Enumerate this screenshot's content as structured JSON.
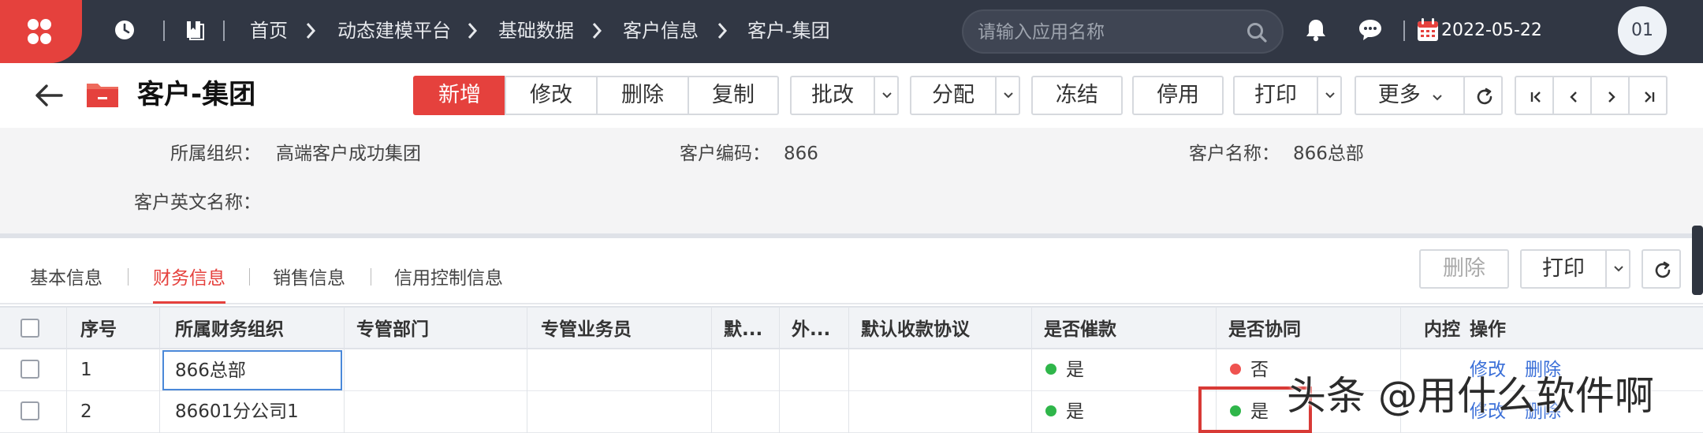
{
  "topbar": {
    "breadcrumbs": [
      "首页",
      "动态建模平台",
      "基础数据",
      "客户信息",
      "客户-集团"
    ],
    "search_placeholder": "请输入应用名称",
    "date": "2022-05-22",
    "avatar": "01",
    "colors": {
      "bar": "#313744",
      "logo_bg": "#e5413d"
    }
  },
  "title": "客户-集团",
  "toolbar": {
    "add": "新增",
    "edit": "修改",
    "delete": "删除",
    "copy": "复制",
    "batch_edit": "批改",
    "assign": "分配",
    "freeze": "冻结",
    "disable": "停用",
    "print": "打印",
    "more": "更多"
  },
  "info": {
    "org_label": "所属组织：",
    "org_value": "高端客户成功集团",
    "code_label": "客户编码：",
    "code_value": "866",
    "name_label": "客户名称：",
    "name_value": "866总部",
    "en_name_label": "客户英文名称："
  },
  "tabs": [
    "基本信息",
    "财务信息",
    "销售信息",
    "信用控制信息"
  ],
  "active_tab": "财务信息",
  "tab_actions": {
    "delete": "删除",
    "print": "打印"
  },
  "grid": {
    "headers": [
      "序号",
      "所属财务组织",
      "专管部门",
      "专管业务员",
      "默...",
      "外...",
      "默认收款协议",
      "是否催款",
      "是否协同",
      "内控",
      "操作"
    ],
    "rows": [
      {
        "seq": "1",
        "org": "866总部",
        "dept": "",
        "staff": "",
        "d1": "",
        "d2": "",
        "protocol": "",
        "dun": "是",
        "dun_status": "green",
        "collab": "否",
        "collab_status": "red",
        "ops": [
          "修改",
          "删除"
        ]
      },
      {
        "seq": "2",
        "org": "86601分公司1",
        "dept": "",
        "staff": "",
        "d1": "",
        "d2": "",
        "protocol": "",
        "dun": "是",
        "dun_status": "green",
        "collab": "是",
        "collab_status": "green",
        "ops": [
          "修改",
          "删除"
        ]
      }
    ],
    "status_colors": {
      "green": "#2fb64a",
      "red": "#ef5350"
    }
  },
  "watermark": "头条 @用什么软件啊"
}
